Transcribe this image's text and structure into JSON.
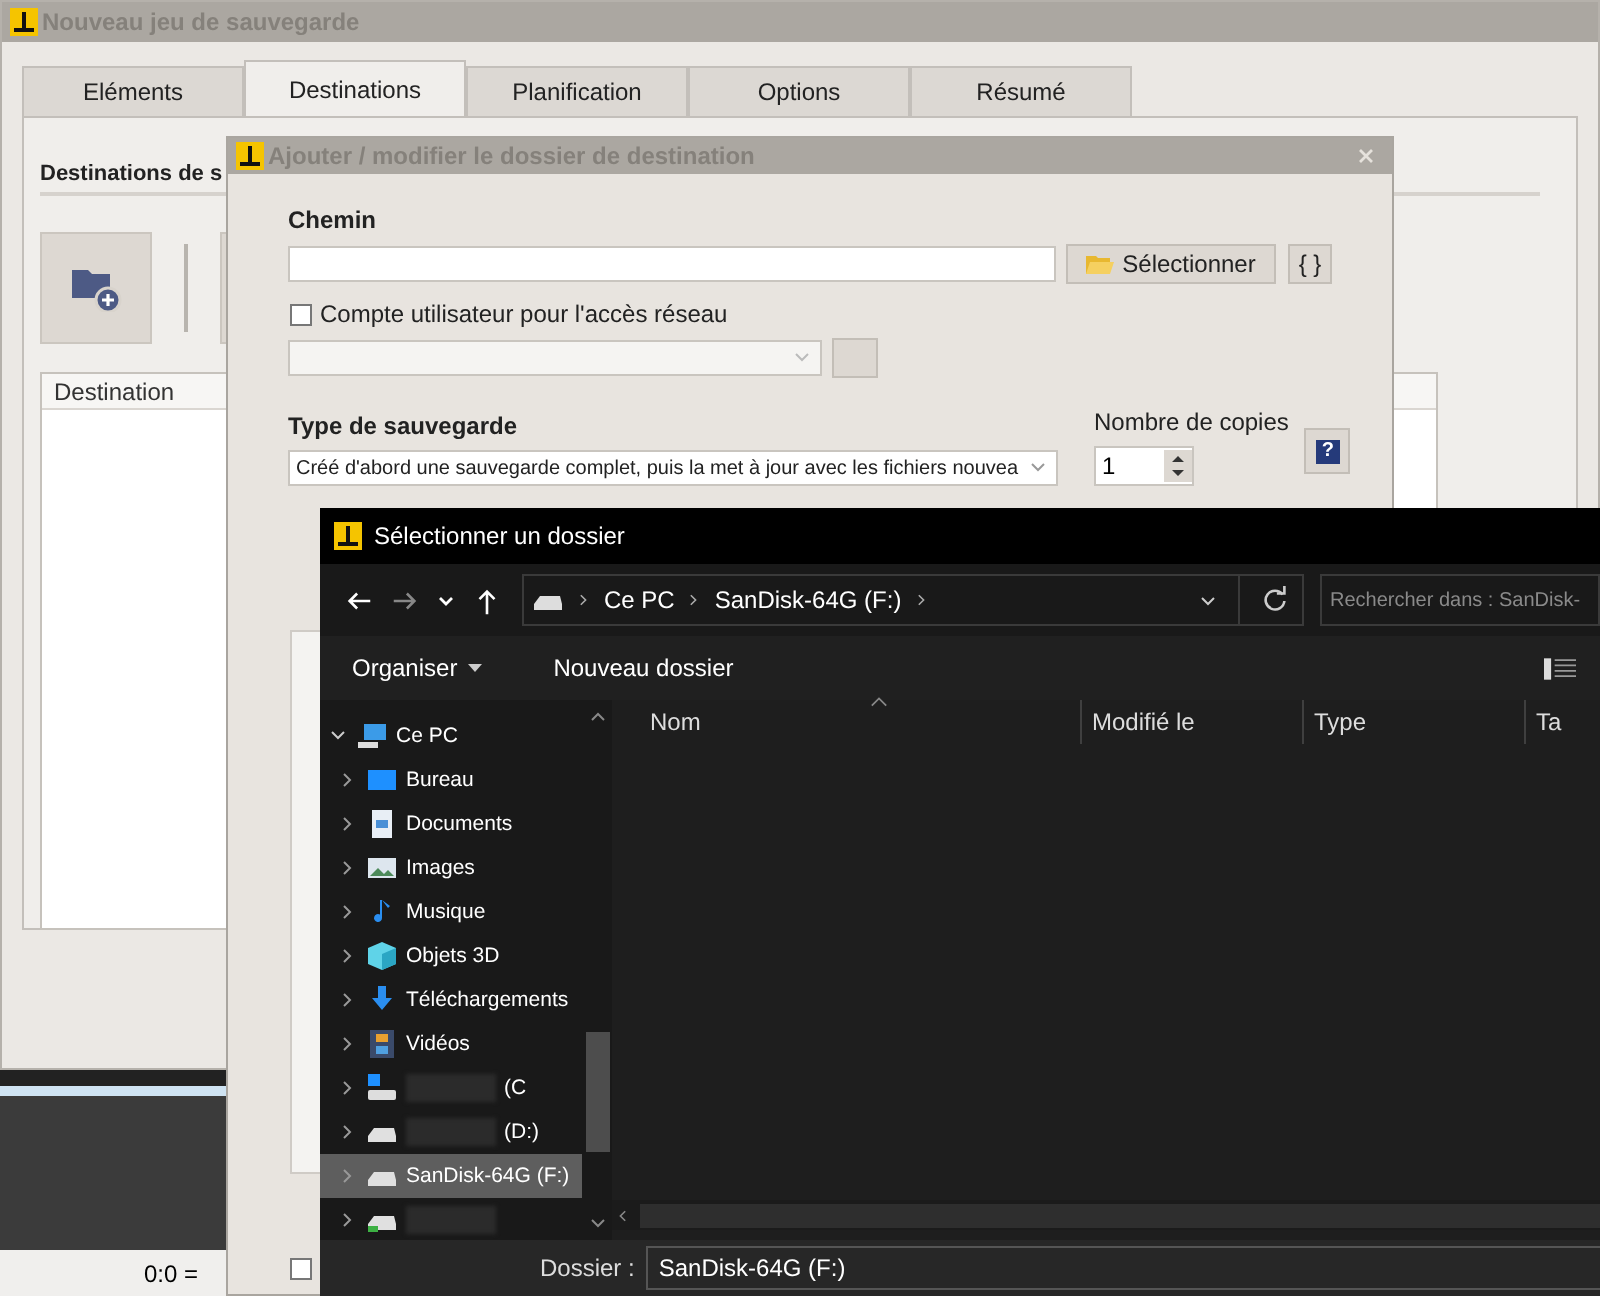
{
  "main_window": {
    "title": "Nouveau jeu de sauvegarde",
    "tabs": [
      {
        "label": "Eléments",
        "selected": false
      },
      {
        "label": "Destinations",
        "selected": true
      },
      {
        "label": "Planification",
        "selected": false
      },
      {
        "label": "Options",
        "selected": false
      },
      {
        "label": "Résumé",
        "selected": false
      }
    ],
    "section_title": "Destinations de s",
    "table": {
      "columns": [
        "Destination"
      ]
    }
  },
  "status_bar": {
    "text": "0:0 ="
  },
  "dest_dialog": {
    "title": "Ajouter / modifier le dossier de destination",
    "path_label": "Chemin",
    "select_button": "Sélectionner",
    "braces_button": "{ }",
    "network_account": {
      "label": "Compte utilisateur pour l'accès réseau",
      "checked": false
    },
    "backup_type_label": "Type de sauvegarde",
    "backup_type_value": "Créé d'abord une sauvegarde complet, puis la met à jour avec les fichiers nouvea",
    "copies_label": "Nombre de copies",
    "copies_value": "1",
    "help_button": "?",
    "bottom_checkbox": {
      "checked": false
    }
  },
  "folder_dialog": {
    "title": "Sélectionner un dossier",
    "breadcrumb": [
      "Ce PC",
      "SanDisk-64G (F:)"
    ],
    "search": {
      "placeholder": "Rechercher dans : SanDisk-"
    },
    "toolbar": {
      "organize": "Organiser",
      "new_folder": "Nouveau dossier"
    },
    "tree": [
      {
        "label": "Ce PC",
        "kind": "pc",
        "expanded": true,
        "selected": false,
        "children": [
          {
            "label": "Bureau",
            "kind": "desktop",
            "expanded": false,
            "selected": false
          },
          {
            "label": "Documents",
            "kind": "documents",
            "expanded": false,
            "selected": false
          },
          {
            "label": "Images",
            "kind": "images",
            "expanded": false,
            "selected": false
          },
          {
            "label": "Musique",
            "kind": "music",
            "expanded": false,
            "selected": false
          },
          {
            "label": "Objets 3D",
            "kind": "cube",
            "expanded": false,
            "selected": false
          },
          {
            "label": "Téléchargements",
            "kind": "downloads",
            "expanded": false,
            "selected": false
          },
          {
            "label": "Vidéos",
            "kind": "videos",
            "expanded": false,
            "selected": false
          },
          {
            "label": "(C",
            "kind": "system-drive",
            "redacted": true,
            "expanded": false,
            "selected": false
          },
          {
            "label": "(D:)",
            "kind": "drive",
            "redacted": true,
            "expanded": false,
            "selected": false
          },
          {
            "label": "SanDisk-64G (F:)",
            "kind": "drive",
            "expanded": false,
            "selected": true
          },
          {
            "kind": "green-drive",
            "redacted": true,
            "expanded": false,
            "selected": false
          }
        ]
      }
    ],
    "columns": [
      "Nom",
      "Modifié le",
      "Type",
      "Ta"
    ],
    "folder_label": "Dossier :",
    "folder_value": "SanDisk-64G (F:)"
  }
}
